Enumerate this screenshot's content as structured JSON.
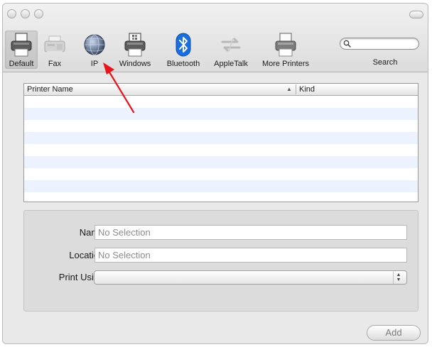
{
  "toolbar": {
    "items": [
      {
        "label": "Default",
        "icon": "printer-icon",
        "selected": true
      },
      {
        "label": "Fax",
        "icon": "fax-icon",
        "selected": false
      },
      {
        "label": "IP",
        "icon": "globe-icon",
        "selected": false
      },
      {
        "label": "Windows",
        "icon": "windows-printer-icon",
        "selected": false
      },
      {
        "label": "Bluetooth",
        "icon": "bluetooth-icon",
        "selected": false
      },
      {
        "label": "AppleTalk",
        "icon": "appletalk-icon",
        "selected": false
      },
      {
        "label": "More Printers",
        "icon": "more-printers-icon",
        "selected": false
      }
    ],
    "search": {
      "label": "Search",
      "value": "",
      "placeholder": ""
    }
  },
  "printer_list": {
    "columns": [
      "Printer Name",
      "Kind"
    ],
    "sorted_column": "Printer Name",
    "sort_indicator": "▲",
    "rows": []
  },
  "details": {
    "name_label": "Name:",
    "name_value": "No Selection",
    "location_label": "Location:",
    "location_value": "No Selection",
    "print_using_label": "Print Using:",
    "print_using_value": ""
  },
  "buttons": {
    "add_label": "Add"
  },
  "colors": {
    "bluetooth": "#1a6fe0",
    "annotation_arrow": "#e8141a",
    "row_alt": "#edf3fe"
  }
}
